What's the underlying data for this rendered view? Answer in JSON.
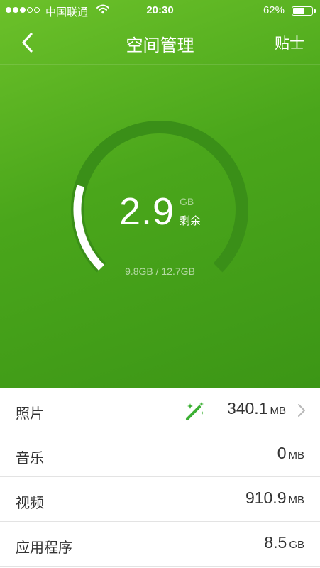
{
  "status_bar": {
    "carrier": "中国联通",
    "time": "20:30",
    "battery_percent": "62%",
    "battery_level": 0.62,
    "signal_strength": 3,
    "signal_max": 5
  },
  "nav": {
    "title": "空间管理",
    "tips_label": "贴士"
  },
  "storage": {
    "remaining_value": "2.9",
    "remaining_unit": "GB",
    "remaining_label": "剩余",
    "usage_text": "9.8GB / 12.7GB",
    "used_fraction": 0.772
  },
  "items": [
    {
      "label": "照片",
      "value": "340.1",
      "unit": "MB"
    },
    {
      "label": "音乐",
      "value": "0",
      "unit": "MB"
    },
    {
      "label": "视频",
      "value": "910.9",
      "unit": "MB"
    },
    {
      "label": "应用程序",
      "value": "8.5",
      "unit": "GB"
    }
  ],
  "icons": {
    "back": "chevron-left-icon",
    "wand": "magic-wand-icon",
    "chevron": "chevron-right-icon",
    "wifi": "wifi-icon",
    "battery": "battery-icon"
  },
  "colors": {
    "hero_green": "#4aa61b",
    "ring_track": "#3a8f18",
    "wand_green": "#3cb034",
    "text_dark": "#333333"
  }
}
